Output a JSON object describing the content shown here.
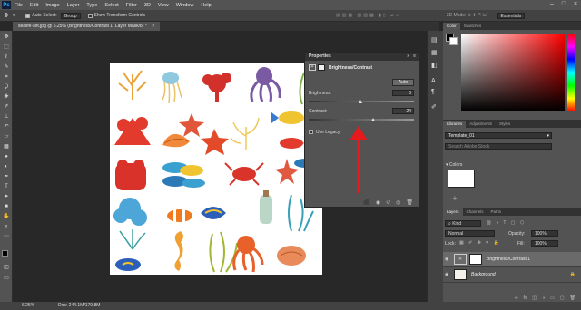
{
  "menubar": {
    "logo": "Ps",
    "items": [
      "File",
      "Edit",
      "Image",
      "Layer",
      "Type",
      "Select",
      "Filter",
      "3D",
      "View",
      "Window",
      "Help"
    ]
  },
  "options": {
    "auto_select_label": "Auto-Select:",
    "auto_select_value": "Group",
    "transform_label": "Show Transform Controls",
    "workspace": "Essentials"
  },
  "document": {
    "tab_title": "sealife-set.jpg @ 6.25% (Brightness/Contrast 1, Layer Mask/8) *",
    "zoom": "6.25%",
    "doc_info": "Doc: 244.1M/179.8M"
  },
  "properties": {
    "panel_title": "Properties",
    "adjustment_title": "Brightness/Contrast",
    "auto_label": "Auto",
    "brightness_label": "Brightness:",
    "brightness_value": "0",
    "contrast_label": "Contrast:",
    "contrast_value": "24",
    "legacy_label": "Use Legacy"
  },
  "color_panel": {
    "tabs": [
      "Color",
      "Swatches"
    ]
  },
  "libraries_panel": {
    "tabs": [
      "Libraries",
      "Adjustments",
      "Styles"
    ],
    "library_name": "Template_01",
    "search_placeholder": "Search Adobe Stock",
    "group_label": "Colors"
  },
  "layers_panel": {
    "tabs": [
      "Layers",
      "Channels",
      "Paths"
    ],
    "filter_label": "Kind",
    "blend_mode": "Normal",
    "opacity_label": "Opacity:",
    "opacity_value": "100%",
    "lock_label": "Lock:",
    "fill_label": "Fill:",
    "fill_value": "100%",
    "layers": [
      {
        "name": "Brightness/Contrast 1"
      },
      {
        "name": "Background"
      }
    ]
  },
  "colors": {
    "accent_arrow": "#e8191c",
    "panel_bg": "#535353",
    "canvas_bg": "#282828"
  }
}
